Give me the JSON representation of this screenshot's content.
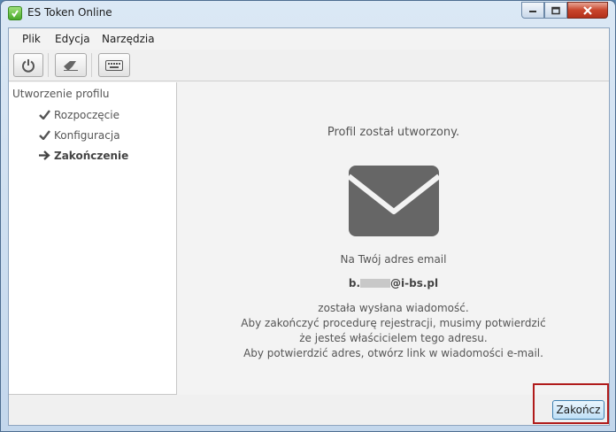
{
  "window": {
    "title": "ES Token Online"
  },
  "menu": [
    "Plik",
    "Edycja",
    "Narzędzia"
  ],
  "toolbar": {
    "buttons": [
      {
        "icon": "power-icon"
      },
      {
        "icon": "eraser-icon"
      },
      {
        "icon": "keyboard-icon"
      }
    ]
  },
  "sidebar": {
    "title": "Utworzenie profilu",
    "steps": [
      {
        "label": "Rozpoczęcie",
        "status": "done",
        "icon": "check-icon"
      },
      {
        "label": "Konfiguracja",
        "status": "done",
        "icon": "check-icon"
      },
      {
        "label": "Zakończenie",
        "status": "current",
        "icon": "arrow-right-icon"
      }
    ]
  },
  "main": {
    "heading": "Profil został utworzony.",
    "icon": "envelope-icon",
    "intro": "Na Twój adres email",
    "email_prefix": "b.",
    "email_suffix": "@i-bs.pl",
    "lines": [
      "została wysłana wiadomość.",
      "Aby zakończyć procedurę rejestracji, musimy potwierdzić",
      "że jesteś właścicielem tego adresu.",
      "Aby potwierdzić adres, otwórz link w wiadomości e-mail."
    ]
  },
  "footer": {
    "finish_label": "Zakończ"
  },
  "colors": {
    "highlight_box": "#b01b1b",
    "envelope": "#666666"
  }
}
